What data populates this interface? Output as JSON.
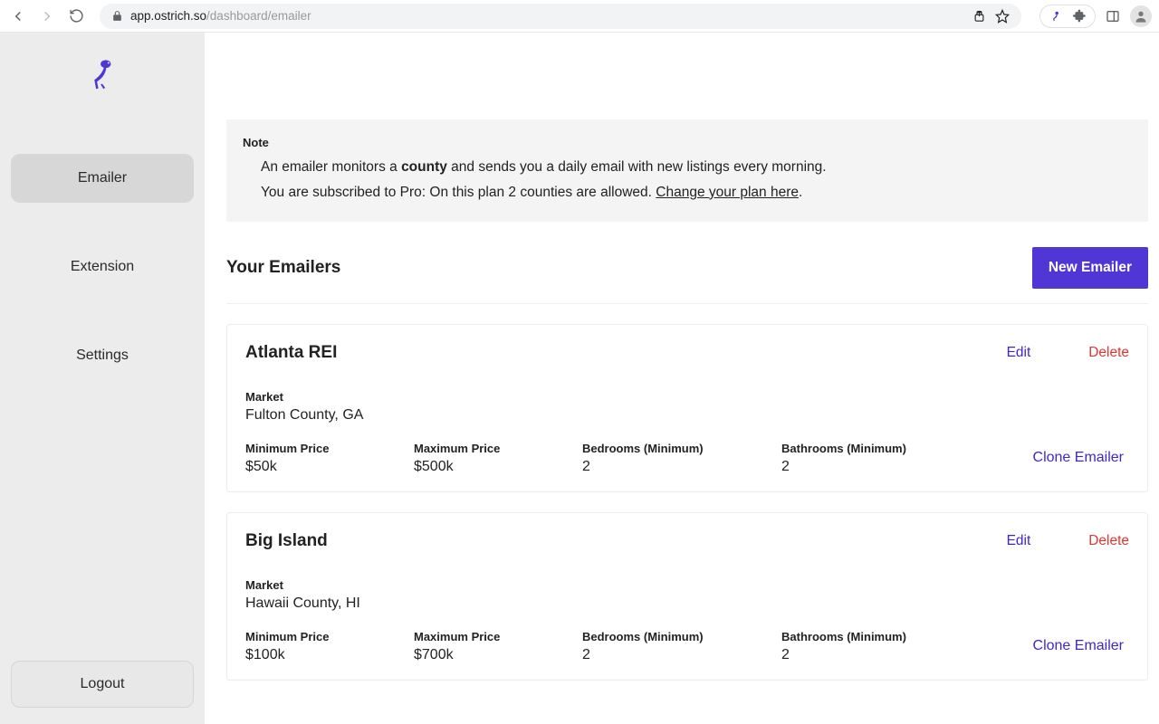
{
  "browser": {
    "url_host": "app.ostrich.so",
    "url_path": "/dashboard/emailer"
  },
  "sidebar": {
    "items": [
      {
        "label": "Emailer"
      },
      {
        "label": "Extension"
      },
      {
        "label": "Settings"
      }
    ],
    "logout_label": "Logout"
  },
  "note": {
    "title": "Note",
    "line1_pre": "An emailer monitors a ",
    "line1_bold": "county",
    "line1_post": " and sends you a daily email with new listings every morning.",
    "line2_pre": "You are subscribed to Pro: On this plan 2 counties are allowed. ",
    "line2_link": "Change your plan here",
    "line2_post": "."
  },
  "section": {
    "title": "Your Emailers",
    "new_button": "New Emailer"
  },
  "labels": {
    "market": "Market",
    "min_price": "Minimum Price",
    "max_price": "Maximum Price",
    "bedrooms": "Bedrooms (Minimum)",
    "bathrooms": "Bathrooms (Minimum)",
    "edit": "Edit",
    "delete": "Delete",
    "clone": "Clone Emailer"
  },
  "emailers": [
    {
      "name": "Atlanta REI",
      "market": "Fulton County, GA",
      "min_price": "$50k",
      "max_price": "$500k",
      "bedrooms": "2",
      "bathrooms": "2"
    },
    {
      "name": "Big Island",
      "market": "Hawaii County, HI",
      "min_price": "$100k",
      "max_price": "$700k",
      "bedrooms": "2",
      "bathrooms": "2"
    }
  ]
}
